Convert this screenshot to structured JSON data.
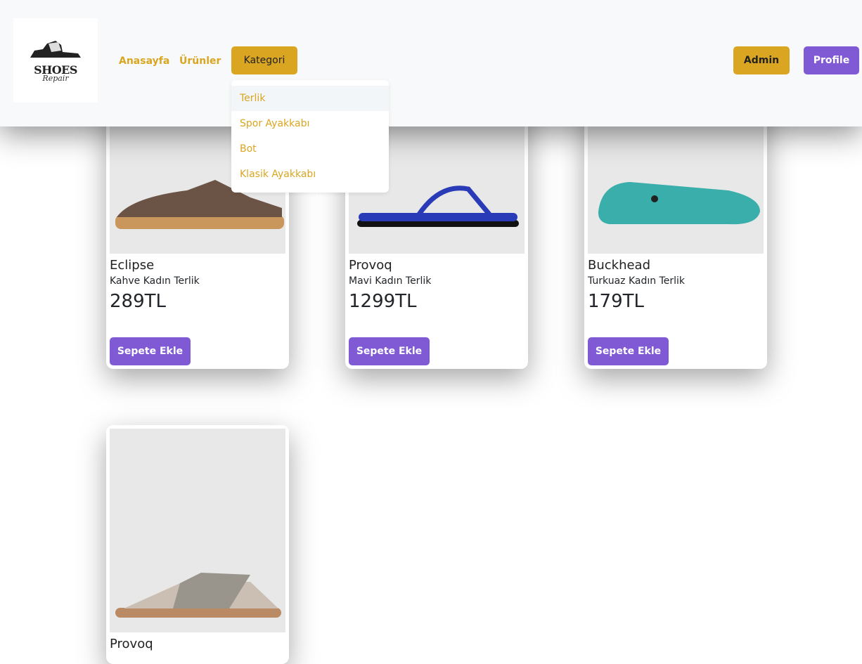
{
  "logo": {
    "line1": "SHOES",
    "line2": "Repair"
  },
  "nav": {
    "home": "Anasayfa",
    "products": "Ürünler",
    "category": "Kategori",
    "admin": "Admin",
    "profile": "Profile"
  },
  "dropdown": [
    "Terlik",
    "Spor Ayakkabı",
    "Bot",
    "Klasik Ayakkabı"
  ],
  "products": [
    {
      "name": "Eclipse",
      "desc": "Kahve Kadın Terlik",
      "price": "289TL",
      "button": "Sepete Ekle",
      "color": "#6b5446"
    },
    {
      "name": "Provoq",
      "desc": "Mavi Kadın Terlik",
      "price": "1299TL",
      "button": "Sepete Ekle",
      "color": "#2a3bb8"
    },
    {
      "name": "Buckhead",
      "desc": "Turkuaz Kadın Terlik",
      "price": "179TL",
      "button": "Sepete Ekle",
      "color": "#3aaeaa"
    },
    {
      "name": "Provoq",
      "color": "#cbbfb3"
    }
  ]
}
